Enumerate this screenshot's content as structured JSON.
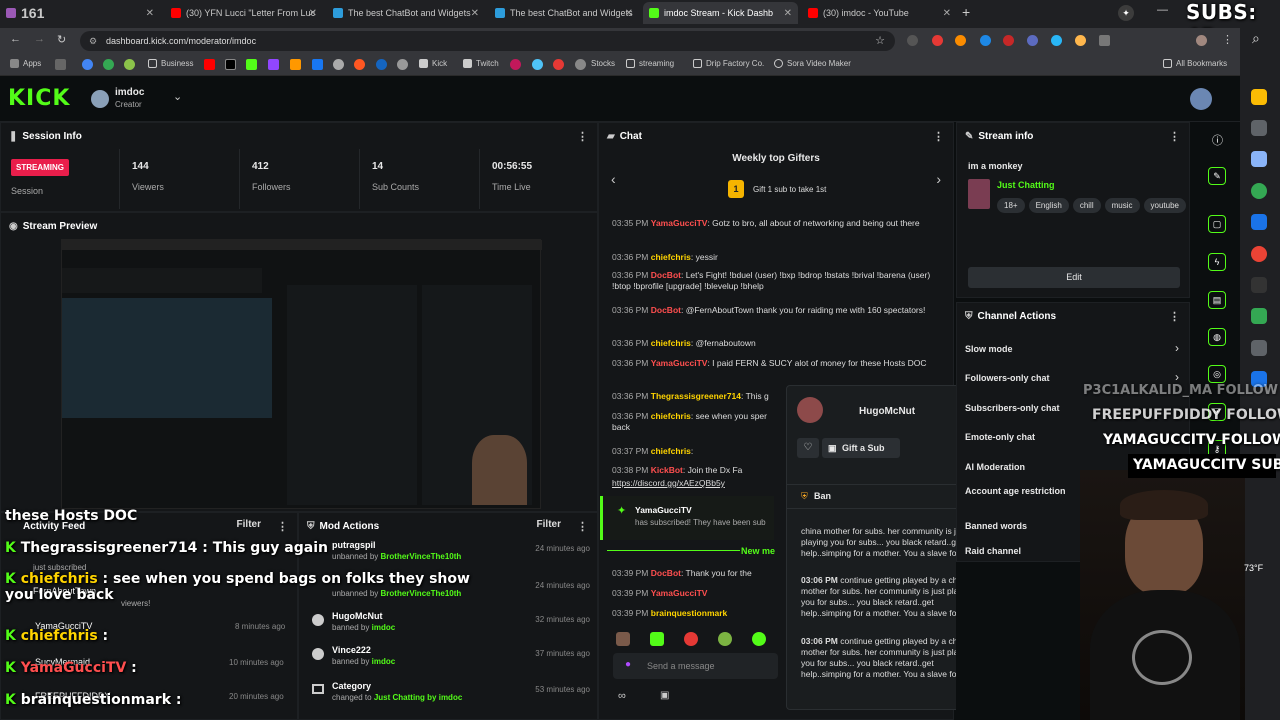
{
  "browser": {
    "tabs": [
      {
        "label": "161",
        "color": "#9b59b6"
      },
      {
        "label": "(30) YFN Lucci \"Letter From Luc",
        "color": "#ff0000"
      },
      {
        "label": "The best ChatBot and Widgets",
        "color": "#2d9cdb"
      },
      {
        "label": "The best ChatBot and Widgets",
        "color": "#2d9cdb"
      },
      {
        "label": "imdoc Stream - Kick Dashb",
        "color": "#53fc18"
      },
      {
        "label": "(30) imdoc - YouTube",
        "color": "#ff0000"
      }
    ],
    "url": "dashboard.kick.com/moderator/imdoc",
    "bookmarks": [
      "Apps",
      "Business",
      "Kick",
      "Twitch",
      "Stocks",
      "streaming",
      "Drip Factory Co.",
      "Sora Video Maker",
      "All Bookmarks"
    ]
  },
  "overlay": {
    "subs": "SUBS: 45",
    "alerts": [
      "P3C1ALKALID_MA  FOLLOW",
      "FREEPUFFDIDDY  FOLLOW",
      "YAMAGUCCITV  FOLLOW",
      "YAMAGUCCITV  SUB"
    ],
    "weather": "73°F",
    "chat_overlay": [
      {
        "user": "",
        "msg": "these Hosts DOC"
      },
      {
        "user": "Thegrassisgreener714",
        "msg": " : This guy again"
      },
      {
        "user": "chiefchris",
        "msg": " : see when you spend bags on folks they show you love back"
      },
      {
        "user": "chiefchris",
        "msg": " : "
      },
      {
        "user": "YamaGucciTV",
        "msg": " : "
      },
      {
        "user": "brainquestionmark",
        "msg": " : "
      }
    ]
  },
  "header": {
    "logo": "KICK",
    "username": "imdoc",
    "role": "Creator"
  },
  "session": {
    "title": "Session Info",
    "badge": "STREAMING",
    "session_label": "Session",
    "stats": [
      {
        "value": "144",
        "label": "Viewers"
      },
      {
        "value": "412",
        "label": "Followers"
      },
      {
        "value": "14",
        "label": "Sub Counts"
      },
      {
        "value": "00:56:55",
        "label": "Time Live"
      }
    ]
  },
  "preview": {
    "title": "Stream Preview"
  },
  "activity": {
    "title": "Activity Feed",
    "filter": "Filter",
    "items": [
      {
        "name": "just subscribed",
        "sub": ""
      },
      {
        "name": "FernAboutTown",
        "sub": "viewers!"
      },
      {
        "name": "YamaGucciTV",
        "sub": ""
      },
      {
        "name": "SucyMermaid",
        "sub": ""
      },
      {
        "name": "FREEPUFFDIDDY",
        "sub": ""
      }
    ],
    "times": [
      "8 minutes ago",
      "10 minutes ago",
      "20 minutes ago"
    ]
  },
  "mod_actions": {
    "title": "Mod Actions",
    "filter": "Filter",
    "items": [
      {
        "name": "putragspil",
        "action": "unbanned by",
        "by": "BrotherVinceThe10th",
        "time": "24 minutes ago"
      },
      {
        "name": "",
        "action": "unbanned by",
        "by": "BrotherVinceThe10th",
        "time": "24 minutes ago"
      },
      {
        "name": "HugoMcNut",
        "action": "banned by",
        "by": "imdoc",
        "time": "32 minutes ago"
      },
      {
        "name": "Vince222",
        "action": "banned by",
        "by": "imdoc",
        "time": "37 minutes ago"
      },
      {
        "name": "Category",
        "action": "changed to",
        "by": "Just Chatting by imdoc",
        "time": "53 minutes ago"
      }
    ]
  },
  "chat": {
    "title": "Chat",
    "gifters_title": "Weekly top Gifters",
    "gifters_sub": "Gift 1 sub to take 1st",
    "messages": [
      {
        "time": "03:35 PM",
        "user": "YamaGucciTV",
        "color": "#ff4f4f",
        "text": ": Gotz to bro, all about of networking and being out there"
      },
      {
        "time": "03:36 PM",
        "user": "chiefchris",
        "color": "#ffd400",
        "text": ": yessir"
      },
      {
        "time": "03:36 PM",
        "user": "DocBot",
        "color": "#ff4f4f",
        "text": ": Let's Fight! !bduel (user) !bxp !bdrop !bstats !brival !barena (user) !btop !bprofile [upgrade] !blevelup !bhelp"
      },
      {
        "time": "03:36 PM",
        "user": "DocBot",
        "color": "#ff4f4f",
        "text": ": @FernAboutTown thank you for raiding me with 160 spectators!"
      },
      {
        "time": "03:36 PM",
        "user": "chiefchris",
        "color": "#ffd400",
        "text": ": @fernaboutown"
      },
      {
        "time": "03:36 PM",
        "user": "YamaGucciTV",
        "color": "#ff4f4f",
        "text": ": I paid FERN & SUCY alot of money for these Hosts DOC"
      },
      {
        "time": "03:36 PM",
        "user": "Thegrassisgreener714",
        "color": "#ffd400",
        "text": ": This g"
      },
      {
        "time": "03:36 PM",
        "user": "chiefchris",
        "color": "#ffd400",
        "text": ": see when you sper back"
      },
      {
        "time": "03:37 PM",
        "user": "chiefchris",
        "color": "#ffd400",
        "text": ":"
      },
      {
        "time": "03:38 PM",
        "user": "KickBot",
        "color": "#ff4f4f",
        "text": ": Join the Dx Fa"
      },
      {
        "time": "",
        "user": "",
        "color": "#fff",
        "text": "https://discord.gg/xAEzQBb5y"
      },
      {
        "time": "03:39 PM",
        "user": "DocBot",
        "color": "#ff4f4f",
        "text": ": Thank you for the"
      },
      {
        "time": "03:39 PM",
        "user": "YamaGucciTV",
        "color": "#ff4f4f",
        "text": ""
      },
      {
        "time": "03:39 PM",
        "user": "brainquestionmark",
        "color": "#ffd400",
        "text": ""
      }
    ],
    "sub_event": {
      "user": "YamaGucciTV",
      "text": "has subscribed! They have been sub"
    },
    "new_messages": "New me",
    "placeholder": "Send a message"
  },
  "user_card": {
    "name": "HugoMcNut",
    "gift_label": "Gift a Sub",
    "ban_label": "Ban",
    "messages": [
      {
        "time": "",
        "text": "china mother for subs. her community is just playing you for subs... you black retard..get help..simping for a mother. You a slave for real"
      },
      {
        "time": "03:06 PM",
        "text": "continue getting played by a china mother for subs. her community is just playing you for subs... you black retard..get help..simping for a mother. You a slave for real"
      },
      {
        "time": "03:06 PM",
        "text": "continue getting played by a china mother for subs. her community is just playing you for subs... you black retard..get help..simping for a mother. You a slave for real"
      }
    ]
  },
  "stream_info": {
    "title": "Stream info",
    "stream_title": "im a monkey",
    "category": "Just Chatting",
    "tags": [
      "18+",
      "English",
      "chill",
      "music",
      "youtube"
    ],
    "edit": "Edit"
  },
  "channel_actions": {
    "title": "Channel Actions",
    "items": [
      "Slow mode",
      "Followers-only chat",
      "Subscribers-only chat",
      "Emote-only chat",
      "AI Moderation",
      "Account age restriction",
      "Banned words",
      "Raid channel"
    ]
  },
  "colors": {
    "kick_green": "#53fc18",
    "streaming_red": "#e91e4b",
    "panel": "#141618"
  }
}
